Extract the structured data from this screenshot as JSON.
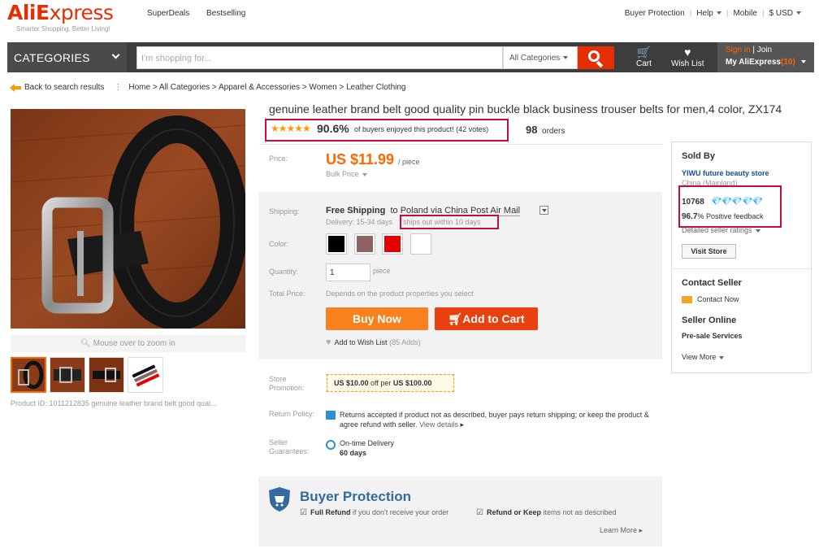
{
  "header": {
    "logo_ali": "Ali",
    "logo_express": "xpress",
    "tagline": "Smarter Shopping, Better Living!",
    "nav": [
      "SuperDeals",
      "Bestselling"
    ],
    "links": [
      "Buyer Protection",
      "Help",
      "Mobile",
      "$ USD"
    ]
  },
  "bar": {
    "categories_label": "CATEGORIES",
    "search_placeholder": "I'm shopping for...",
    "search_category": "All Categories",
    "cart_label": "Cart",
    "wishlist_label": "Wish List",
    "sign_in": "Sign in",
    "join": "Join",
    "my_aliexpress": "My AliExpress",
    "my_count": "(10)"
  },
  "breadcrumb": {
    "back": "Back to search results",
    "path": "Home > All Categories > Apparel & Accessories > Women > Leather Clothing"
  },
  "gallery": {
    "zoom_hint": "Mouse over to zoom in",
    "product_id": "Product ID: 1011212835 genuine leather brand belt good qual..."
  },
  "product": {
    "title": "genuine leather brand belt good quality pin buckle black business trouser belts for men,4 color, ZX174",
    "stars": "★★★★★",
    "rating_pct": "90.6%",
    "rating_text": "of buyers enjoyed this product! (42 votes)",
    "orders_count": "98",
    "orders_label": "orders",
    "price_label": "Price:",
    "price": "US $11.99",
    "price_unit": "/ piece",
    "bulk_price": "Bulk Price",
    "shipping_label": "Shipping:",
    "free_shipping": "Free Shipping",
    "ship_to": "to",
    "ship_dest": "Poland via China Post Air Mail",
    "delivery": "Delivery: 15-34 days",
    "ships_out": "ships out within 10 days",
    "color_label": "Color:",
    "colors": [
      "#000000",
      "#8c6262",
      "#e60000",
      "#ffffff"
    ],
    "quantity_label": "Quantity:",
    "quantity": "1",
    "quantity_unit": "piece",
    "total_label": "Total Price:",
    "total_value": "Depends on the product properties you select",
    "buy_now": "Buy Now",
    "add_to_cart": "Add to Cart",
    "wish_list": "Add to Wish List",
    "wish_count": "(85 Adds)",
    "promotion_label": "Store Promotion:",
    "promo_amount": "US $10.00",
    "promo_mid": "off per",
    "promo_threshold": "US $100.00",
    "return_label": "Return Policy:",
    "return_text": "Returns accepted if product not as described, buyer pays return shipping; or keep the product & agree refund with seller.",
    "view_details": "View details",
    "guarantee_label": "Seller Guarantees:",
    "ontime": "On-time Delivery",
    "days": "60 days"
  },
  "buyer_protection": {
    "title": "Buyer Protection",
    "full_refund": "Full Refund",
    "full_refund_text": "if you don't receive your order",
    "refund_keep": "Refund or Keep",
    "refund_keep_text": "items not as described",
    "learn_more": "Learn More"
  },
  "seller": {
    "sold_by": "Sold By",
    "store": "YIWU future beauty store",
    "location": "China (Mainland)",
    "score": "10768",
    "diamonds": "💎💎💎💎💎",
    "positive_pct": "96.7",
    "positive_label": "% Positive feedback",
    "detailed": "Detailed seller ratings",
    "visit_store": "Visit Store",
    "contact_seller": "Contact Seller",
    "contact_now": "Contact Now",
    "seller_online": "Seller Online",
    "presale": "Pre-sale Services",
    "view_more": "View More"
  },
  "accent_colors": {
    "brand": "#e62e04",
    "orange": "#f60",
    "highlight_box": "#c0103a"
  }
}
